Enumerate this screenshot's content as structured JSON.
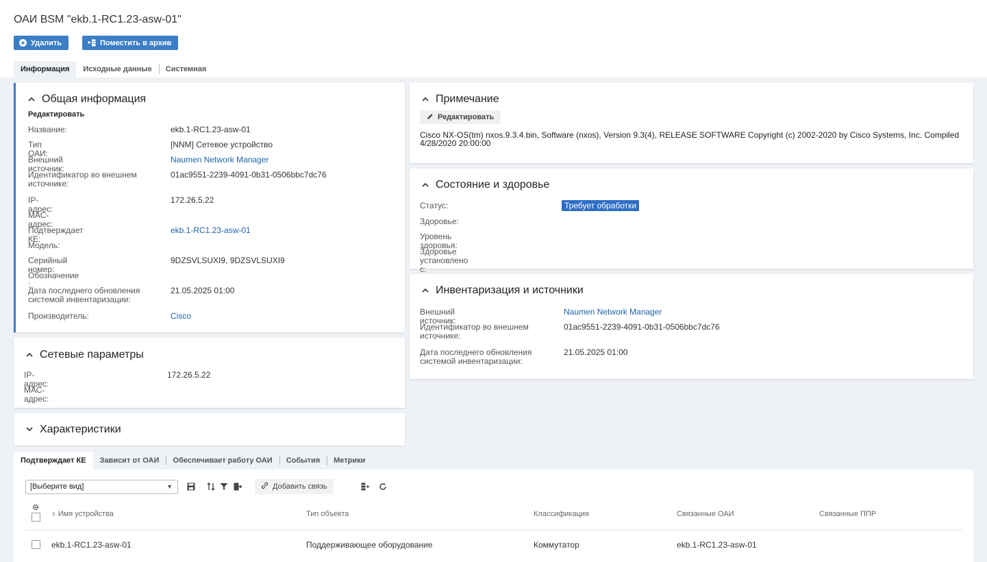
{
  "page": {
    "title": "ОАИ BSM \"ekb.1-RC1.23-asw-01\""
  },
  "actions": {
    "delete_label": "Удалить",
    "archive_label": "Поместить в архив"
  },
  "top_tabs": [
    {
      "label": "Информация",
      "active": true
    },
    {
      "label": "Исходные данные",
      "active": false
    },
    {
      "label": "Системная",
      "active": false
    }
  ],
  "general": {
    "title": "Общая информация",
    "edit_label": "Редактировать",
    "rows": [
      {
        "label": "Название:",
        "value": "ekb.1-RC1.23-asw-01",
        "link": false
      },
      {
        "label": "Тип ОАИ:",
        "value": "[NNM] Сетевое устройство",
        "link": false
      },
      {
        "label": "Внешний источник:",
        "value": "Naumen Network Manager",
        "link": true
      },
      {
        "label": "Идентификатор во внешнем источнике:",
        "value": "01ac9551-2239-4091-0b31-0506bbc7dc76",
        "link": false
      },
      {
        "label": "IP-адрес:",
        "value": "172.26.5.22",
        "link": false
      },
      {
        "label": "МАС-адрес:",
        "value": "",
        "link": false
      },
      {
        "label": "Подтверждает КЕ:",
        "value": "ekb.1-RC1.23-asw-01",
        "link": true
      },
      {
        "label": "Модель:",
        "value": "",
        "link": false
      },
      {
        "label": "Серийный номер:",
        "value": "9DZSVLSUXI9, 9DZSVLSUXI9",
        "link": false
      },
      {
        "label": "Обозначение :",
        "value": "",
        "link": false
      },
      {
        "label": "Дата последнего обновления системой инвентаризации:",
        "value": "21.05.2025 01:00",
        "link": false
      },
      {
        "label": "Производитель:",
        "value": "Cisco",
        "link": true
      }
    ]
  },
  "network": {
    "title": "Сетевые параметры",
    "rows": [
      {
        "label": "IP-адрес:",
        "value": "172.26.5.22"
      },
      {
        "label": "МАС-адрес:",
        "value": ""
      }
    ]
  },
  "characteristics": {
    "title": "Характеристики"
  },
  "note": {
    "title": "Примечание",
    "edit_label": "Редактировать",
    "text": "Cisco NX-OS(tm) nxos.9.3.4.bin, Software (nxos), Version 9.3(4), RELEASE SOFTWARE Copyright (c) 2002-2020 by Cisco Systems, Inc. Compiled 4/28/2020 20:00:00"
  },
  "health": {
    "title": "Состояние и здоровье",
    "rows": [
      {
        "label": "Статус:",
        "value": "Требует обработки"
      },
      {
        "label": "Здоровье:",
        "value": ""
      },
      {
        "label": "Уровень здоровья:",
        "value": ""
      },
      {
        "label": "Здоровье установлено с:",
        "value": ""
      }
    ],
    "status_color": "#2e6ec7"
  },
  "inventory": {
    "title": "Инвентаризация и источники",
    "rows": [
      {
        "label": "Внешний источник:",
        "value": "Naumen Network Manager",
        "link": true
      },
      {
        "label": "Идентификатор во внешнем источнике:",
        "value": "01ac9551-2239-4091-0b31-0506bbc7dc76",
        "link": false
      },
      {
        "label": "Дата последнего обновления системой инвентаризации:",
        "value": "21.05.2025 01:00",
        "link": false
      }
    ]
  },
  "bottom_tabs": [
    {
      "label": "Подтверждает КЕ",
      "active": true
    },
    {
      "label": "Зависит от ОАИ",
      "active": false
    },
    {
      "label": "Обеспечивает работу ОАИ",
      "active": false
    },
    {
      "label": "События",
      "active": false
    },
    {
      "label": "Метрики",
      "active": false
    }
  ],
  "table": {
    "view_select": "[Выберите вид]",
    "add_link_label": "Добавить связь",
    "columns": [
      "Имя устройства",
      "Тип объекта",
      "Классификация",
      "Связанные ОАИ",
      "Связанные ППР"
    ],
    "rows": [
      {
        "name": "ekb.1-RC1.23-asw-01",
        "type": "Поддерживающее оборудование",
        "class": "Коммутатор",
        "oai": "ekb.1-RC1.23-asw-01",
        "ppr": ""
      }
    ]
  },
  "colors": {
    "accent": "#3b7ec6",
    "link": "#1e63a8",
    "background": "#eef1f6"
  }
}
